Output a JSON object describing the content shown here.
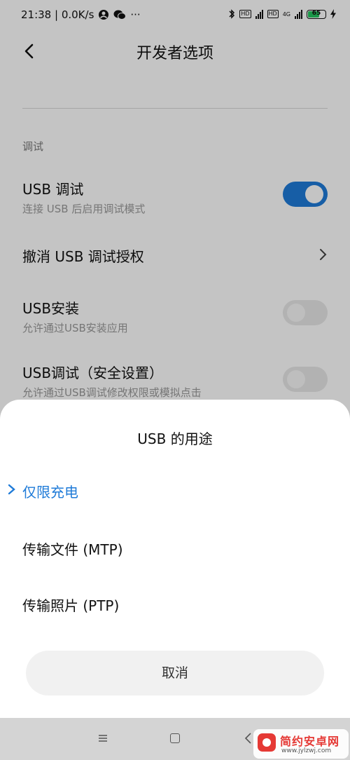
{
  "status_bar": {
    "time_and_speed": "21:38 | 0.0K/s",
    "more": "···",
    "network_label": "4G",
    "battery_level": "65"
  },
  "header": {
    "title": "开发者选项"
  },
  "section": {
    "label": "调试"
  },
  "settings": {
    "usb_debugging": {
      "title": "USB 调试",
      "subtitle": "连接 USB 后启用调试模式",
      "enabled": true
    },
    "revoke_usb_auth": {
      "title": "撤消 USB 调试授权"
    },
    "usb_install": {
      "title": "USB安装",
      "subtitle": "允许通过USB安装应用",
      "enabled": false
    },
    "usb_debugging_security": {
      "title": "USB调试（安全设置）",
      "subtitle": "允许通过USB调试修改权限或模拟点击",
      "enabled": false
    }
  },
  "sheet": {
    "title": "USB 的用途",
    "options": [
      {
        "label": "仅限充电",
        "selected": true
      },
      {
        "label": "传输文件 (MTP)",
        "selected": false
      },
      {
        "label": "传输照片 (PTP)",
        "selected": false
      }
    ],
    "cancel_label": "取消"
  },
  "watermark": {
    "name": "简约安卓网",
    "url": "www.jylzwj.com"
  },
  "colors": {
    "accent": "#1f7bd8",
    "watermark_red": "#e53935",
    "battery_green": "#22c55e"
  }
}
